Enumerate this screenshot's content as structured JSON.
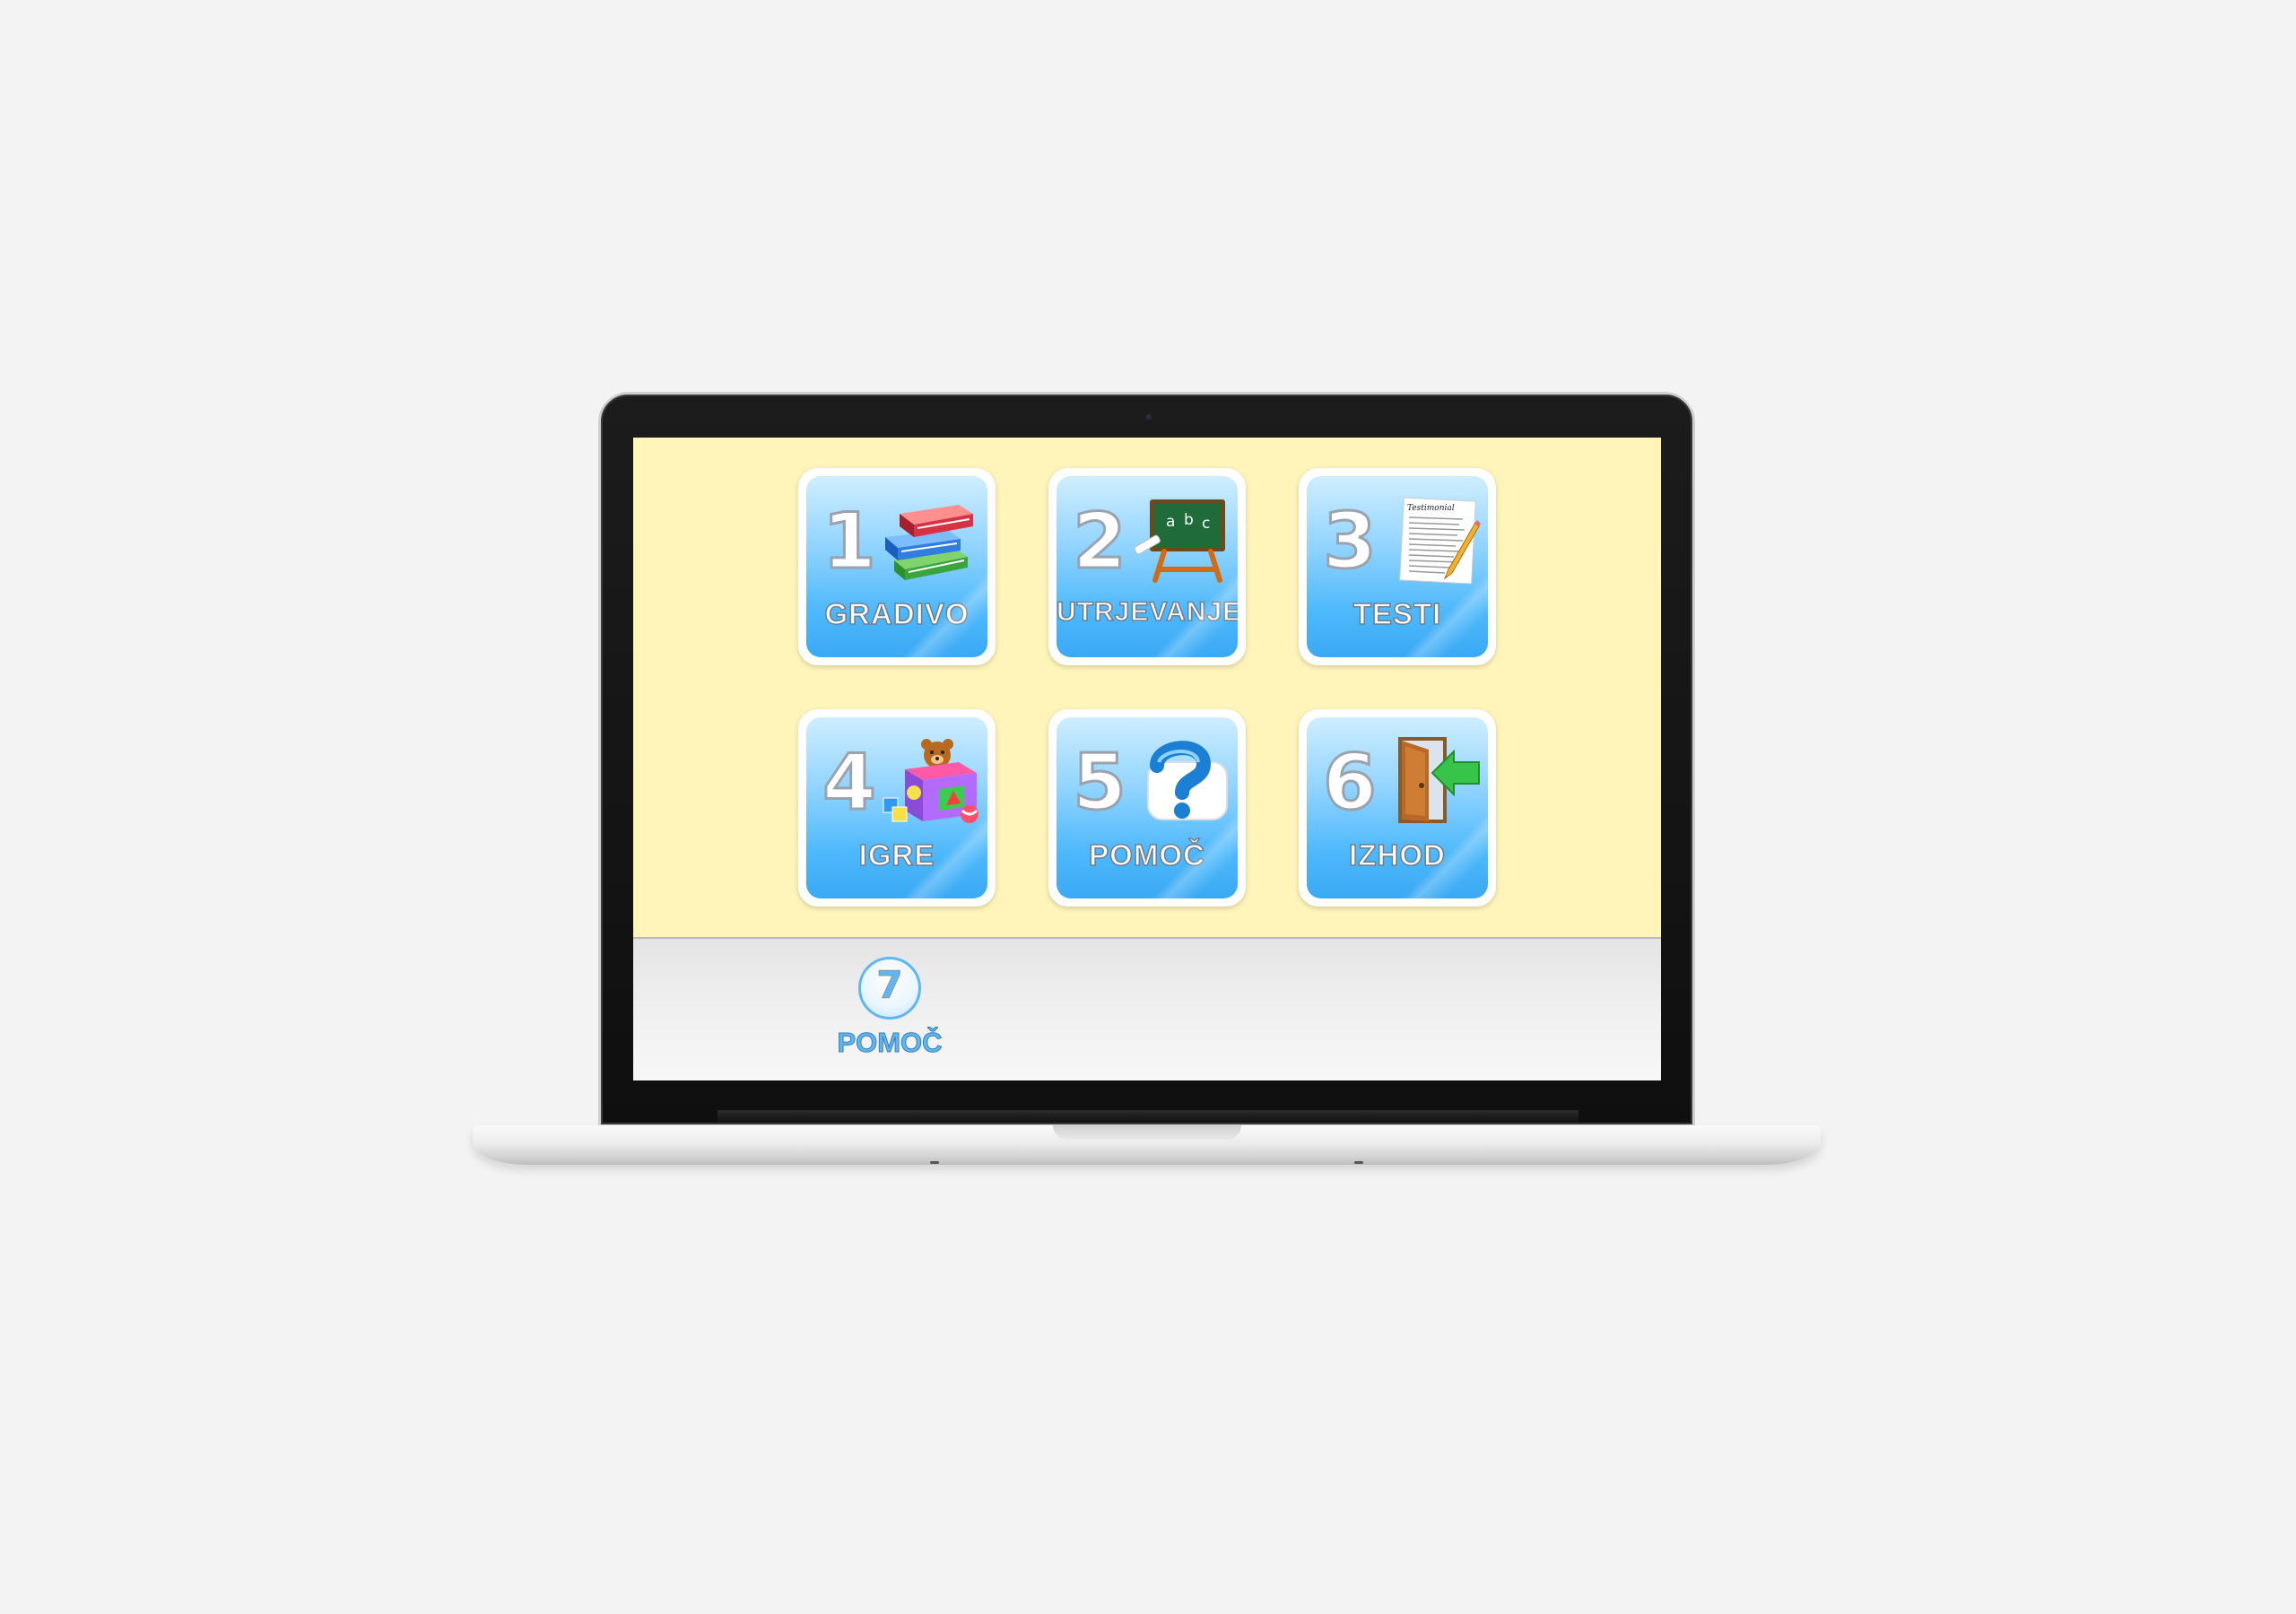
{
  "menu": {
    "tiles": [
      {
        "number": "1",
        "label": "GRADIVO",
        "icon": "books-icon"
      },
      {
        "number": "2",
        "label": "UTRJEVANJE",
        "icon": "chalkboard-icon"
      },
      {
        "number": "3",
        "label": "TESTI",
        "icon": "test-paper-icon"
      },
      {
        "number": "4",
        "label": "IGRE",
        "icon": "toy-box-icon"
      },
      {
        "number": "5",
        "label": "POMOČ",
        "icon": "question-mark-icon"
      },
      {
        "number": "6",
        "label": "IZHOD",
        "icon": "exit-door-icon"
      }
    ],
    "paper_heading": "Testimonial"
  },
  "bottom_bar": {
    "help_number": "7",
    "help_label": "POMOČ",
    "icon": "help-circle-icon"
  },
  "colors": {
    "screen_background": "#fff5bb",
    "tile_gradient_top": "#cfeeff",
    "tile_gradient_bottom": "#3aa9f4",
    "accent": "#5fb7f2"
  }
}
